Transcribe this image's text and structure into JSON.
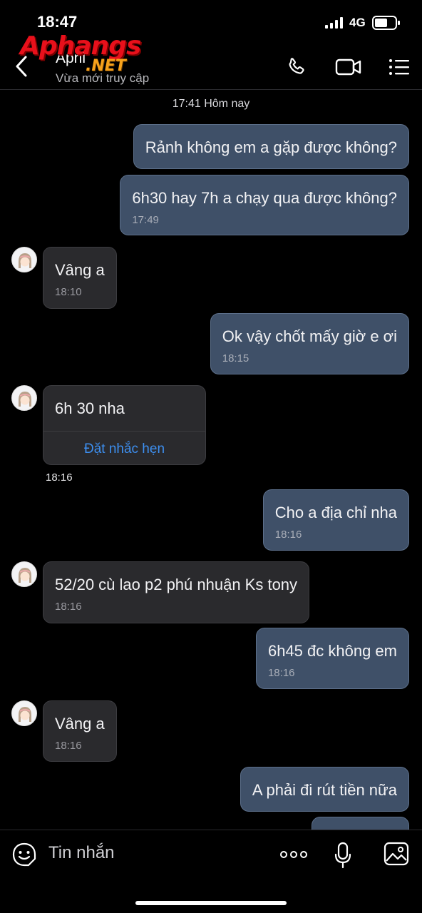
{
  "status_bar": {
    "time": "18:47",
    "network": "4G"
  },
  "header": {
    "contact_name": "April",
    "contact_status": "Vừa mới truy cập"
  },
  "watermark": {
    "main": "Aphangs",
    "sub": ".NET"
  },
  "chat": {
    "date_separator": "17:41 Hôm nay",
    "messages": [
      {
        "dir": "out",
        "text": "Rảnh không em a gặp được không?",
        "time": ""
      },
      {
        "dir": "out",
        "text": "6h30 hay 7h a chạy qua được không?",
        "time": "17:49"
      },
      {
        "dir": "in",
        "text": "Vâng a",
        "time": "18:10"
      },
      {
        "dir": "out",
        "text": "Ok vậy chốt mấy giờ e ơi",
        "time": "18:15"
      },
      {
        "dir": "in",
        "text": "6h 30 nha",
        "action": "Đặt nhắc hẹn",
        "outer_time": "18:16"
      },
      {
        "dir": "out",
        "text": "Cho a địa chỉ nha",
        "time": "18:16"
      },
      {
        "dir": "in",
        "text": "52/20 cù lao p2 phú nhuận Ks tony",
        "time": "18:16"
      },
      {
        "dir": "out",
        "text": "6h45 đc không em",
        "time": "18:16"
      },
      {
        "dir": "in",
        "text": "Vâng a",
        "time": "18:16"
      },
      {
        "dir": "out",
        "text": "A phải đi rút tiền nữa",
        "time": ""
      }
    ]
  },
  "composer": {
    "placeholder": "Tin nhắn"
  },
  "icons": [
    "back-icon",
    "phone-icon",
    "video-call-icon",
    "menu-icon",
    "sticker-icon",
    "more-icon",
    "microphone-icon",
    "image-icon"
  ],
  "colors": {
    "outgoing_bubble": "#3f5068",
    "incoming_bubble": "#2a2a2d",
    "link": "#3d8ff0"
  }
}
